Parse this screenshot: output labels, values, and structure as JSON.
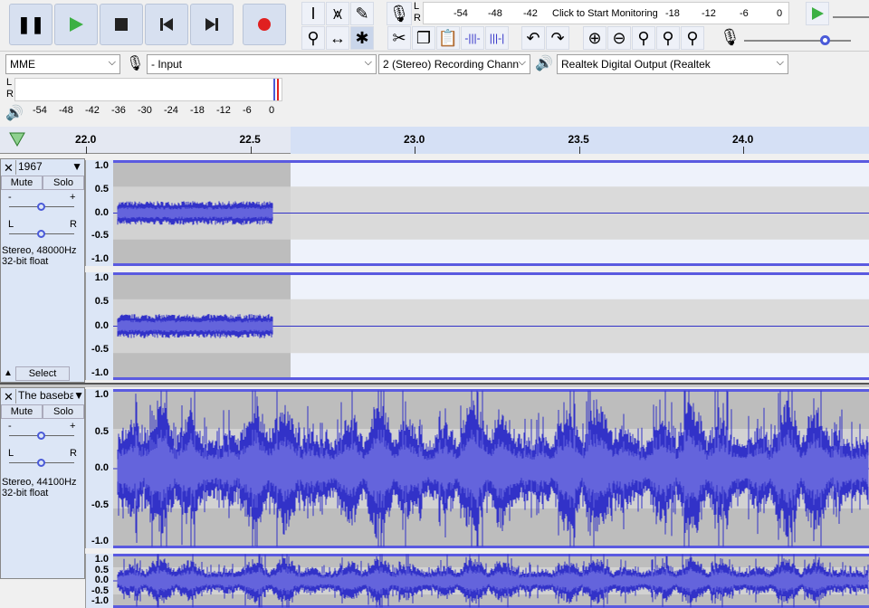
{
  "transport": {
    "buttons": [
      "pause",
      "play",
      "stop",
      "skip-to-start",
      "skip-to-end",
      "record"
    ]
  },
  "tools": {
    "row1": [
      "selection-tool",
      "envelope-tool",
      "draw-tool"
    ],
    "row2": [
      "zoom-tool",
      "timeshift-tool",
      "multi-tool"
    ]
  },
  "record_meter": {
    "l": "L",
    "r": "R",
    "ticks": [
      "-54",
      "-48",
      "-42",
      "-18",
      "-12",
      "-6",
      "0"
    ],
    "prompt": "Click to Start Monitoring"
  },
  "edit": {
    "buttons": [
      "cut",
      "copy",
      "paste",
      "trim",
      "silence",
      "undo",
      "redo",
      "zoom-in",
      "zoom-out",
      "fit-selection",
      "fit-project",
      "zoom-toggle"
    ]
  },
  "devices": {
    "host": "MME",
    "input": "- Input",
    "channels": "2 (Stereo) Recording Chann",
    "output": "Realtek Digital Output (Realtek"
  },
  "play_meter": {
    "l": "L",
    "r": "R",
    "ticks": [
      "-54",
      "-48",
      "-42",
      "-36",
      "-30",
      "-24",
      "-18",
      "-12",
      "-6",
      "0"
    ]
  },
  "timeline": {
    "ticks": [
      "22.0",
      "22.5",
      "23.0",
      "23.5",
      "24.0"
    ]
  },
  "tracks": [
    {
      "name": "1967",
      "mute": "Mute",
      "solo": "Solo",
      "info1": "Stereo, 48000Hz",
      "info2": "32-bit float",
      "select": "Select",
      "gain_minus": "-",
      "gain_plus": "+",
      "pan_l": "L",
      "pan_r": "R"
    },
    {
      "name": "The baseball",
      "mute": "Mute",
      "solo": "Solo",
      "info1": "Stereo, 44100Hz",
      "info2": "32-bit float",
      "gain_minus": "-",
      "gain_plus": "+",
      "pan_l": "L",
      "pan_r": "R"
    }
  ],
  "vruler": [
    "1.0",
    "0.5",
    "0.0",
    "-0.5",
    "-1.0"
  ],
  "colors": {
    "wave": "#3232c8",
    "accent": "#5a5ae0",
    "play": "#3cb043",
    "record": "#e02020"
  }
}
